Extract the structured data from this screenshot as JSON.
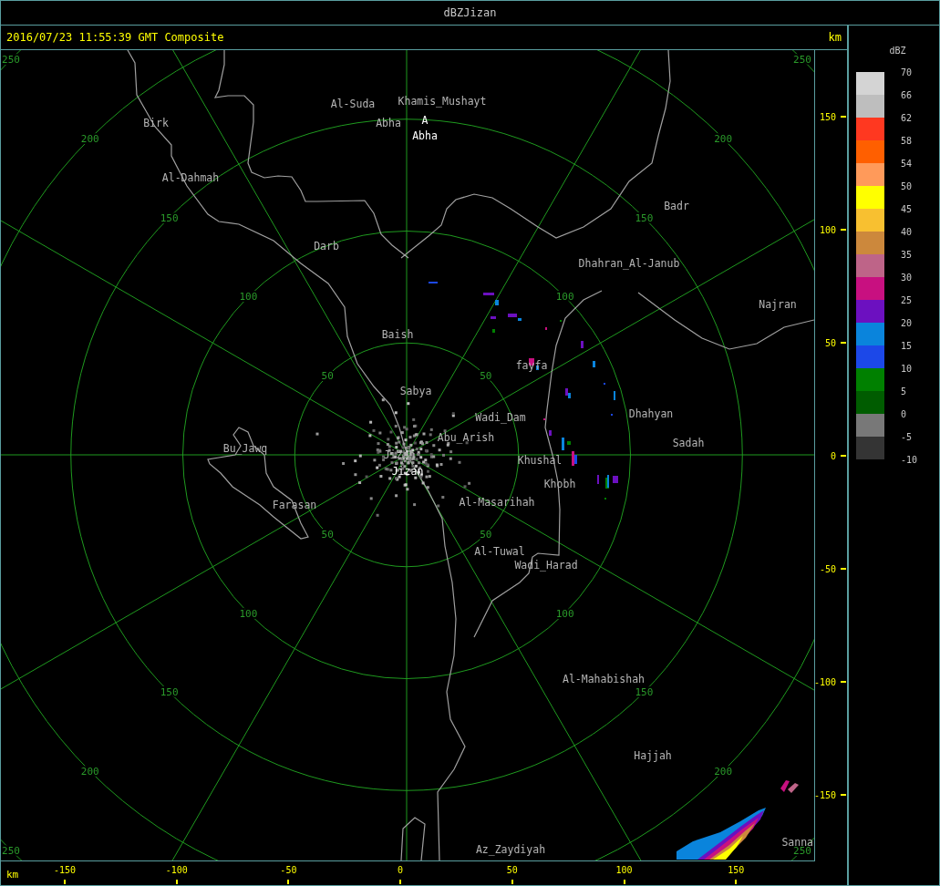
{
  "window": {
    "title": "dBZJizan"
  },
  "header": {
    "timestamp": "2016/07/23 11:55:39 GMT Composite",
    "unit": "km"
  },
  "map": {
    "range_rings": [
      {
        "labels": [
          "50",
          "50",
          "50",
          "50"
        ]
      },
      {
        "labels": [
          "100",
          "100",
          "100",
          "100"
        ]
      },
      {
        "labels": [
          "150",
          "150",
          "150",
          "150"
        ]
      },
      {
        "labels": [
          "200",
          "200",
          "200",
          "200"
        ]
      },
      {
        "labels": [
          "250",
          "250",
          "250",
          "250"
        ]
      }
    ],
    "places": [
      {
        "name": "Al-Suda",
        "kind": "town"
      },
      {
        "name": "Khamis_Mushayt",
        "kind": "town"
      },
      {
        "name": "Birk",
        "kind": "town"
      },
      {
        "name": "Abha",
        "kind": "town"
      },
      {
        "name": "A",
        "kind": "station"
      },
      {
        "name": "Abha",
        "kind": "station"
      },
      {
        "name": "Al-Dahmah",
        "kind": "town"
      },
      {
        "name": "Badr",
        "kind": "town"
      },
      {
        "name": "Darb",
        "kind": "town"
      },
      {
        "name": "Dhahran_Al-Janub",
        "kind": "town"
      },
      {
        "name": "Najran",
        "kind": "town"
      },
      {
        "name": "Baish",
        "kind": "town"
      },
      {
        "name": "fayfa",
        "kind": "town"
      },
      {
        "name": "Sabya",
        "kind": "town"
      },
      {
        "name": "Wadi_Dam",
        "kind": "town"
      },
      {
        "name": "Dhahyan",
        "kind": "town"
      },
      {
        "name": "Bu_Jawq",
        "kind": "town"
      },
      {
        "name": "Abu_Arish",
        "kind": "town"
      },
      {
        "name": "Sadah",
        "kind": "town"
      },
      {
        "name": "Jizan",
        "kind": "town"
      },
      {
        "name": "Khushal",
        "kind": "town"
      },
      {
        "name": "Jizan",
        "kind": "station"
      },
      {
        "name": "Khobh",
        "kind": "town"
      },
      {
        "name": "Farasan",
        "kind": "town"
      },
      {
        "name": "Al-Masarihah",
        "kind": "town"
      },
      {
        "name": "Al-Tuwal",
        "kind": "town"
      },
      {
        "name": "Wadi_Harad",
        "kind": "town"
      },
      {
        "name": "Al-Mahabishah",
        "kind": "town"
      },
      {
        "name": "Hajjah",
        "kind": "town"
      },
      {
        "name": "Az_Zaydiyah",
        "kind": "town"
      },
      {
        "name": "Sanna",
        "kind": "town"
      }
    ]
  },
  "y_axis": {
    "ticks": [
      "150",
      "100",
      "50",
      "0",
      "-50",
      "-100",
      "-150"
    ]
  },
  "x_axis": {
    "unit": "km",
    "ticks": [
      "-150",
      "-100",
      "-50",
      "0",
      "50",
      "100",
      "150"
    ]
  },
  "legend": {
    "title": "dBZ",
    "bands": [
      {
        "label": "70",
        "color": "#d4d4d4"
      },
      {
        "label": "66",
        "color": "#bebebe"
      },
      {
        "label": "62",
        "color": "#ff3820"
      },
      {
        "label": "58",
        "color": "#ff5f00"
      },
      {
        "label": "54",
        "color": "#ff9a5a"
      },
      {
        "label": "50",
        "color": "#ffff00"
      },
      {
        "label": "45",
        "color": "#f8c030"
      },
      {
        "label": "40",
        "color": "#cc883c"
      },
      {
        "label": "35",
        "color": "#be6488"
      },
      {
        "label": "30",
        "color": "#c81080"
      },
      {
        "label": "25",
        "color": "#6c10c0"
      },
      {
        "label": "20",
        "color": "#0a84dc"
      },
      {
        "label": "15",
        "color": "#1c48e8"
      },
      {
        "label": "10",
        "color": "#008000"
      },
      {
        "label": "5",
        "color": "#005c00"
      },
      {
        "label": "0",
        "color": "#787878"
      },
      {
        "label": "-5",
        "color": "#343434"
      }
    ],
    "end_label": "-10"
  }
}
